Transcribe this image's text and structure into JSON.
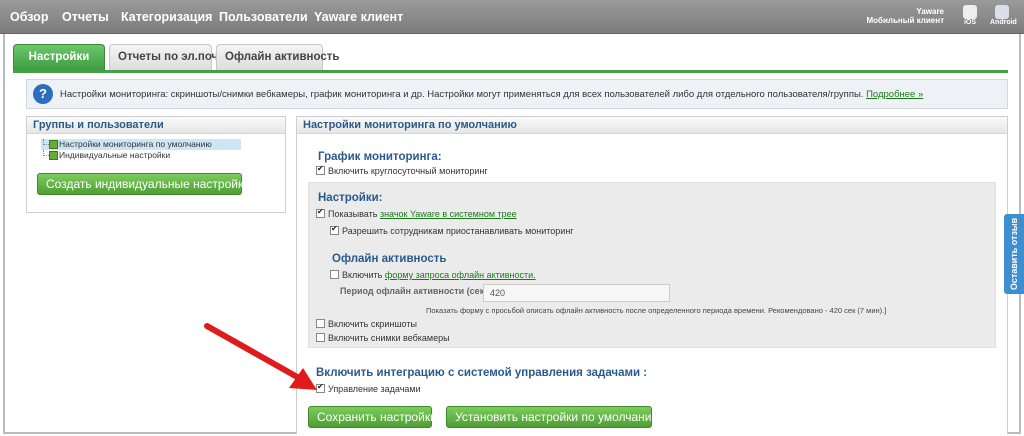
{
  "topnav": {
    "items": [
      "Обзор",
      "Отчеты",
      "Категоризация",
      "Пользователи",
      "Yaware клиент"
    ],
    "mobile_title": "Yaware",
    "mobile_subtitle": "Мобильный клиент",
    "ios_label": "iOS",
    "android_label": "Android"
  },
  "tabs": [
    {
      "label": "Настройки",
      "active": true
    },
    {
      "label": "Отчеты по эл.почте",
      "active": false
    },
    {
      "label": "Офлайн активность",
      "active": false
    }
  ],
  "info": {
    "text": "Настройки мониторинга: скриншоты/снимки вебкамеры, график мониторинга и др. Настройки могут применяться для всех пользователей либо для отдельного пользователя/группы.",
    "link": "Подробнее »"
  },
  "left_panel": {
    "title": "Группы и пользователи",
    "tree": [
      "Настройки мониторинга по умолчанию",
      "Индивидуальные настройки"
    ],
    "create_button": "Создать индивидуальные настройки"
  },
  "right_panel": {
    "title": "Настройки мониторинга по умолчанию",
    "schedule": {
      "title": "График мониторинга:",
      "round_clock": {
        "label": "Включить круглосуточный мониторинг",
        "checked": true
      }
    },
    "settings": {
      "title": "Настройки:",
      "show_prefix": "Показывать",
      "show_link": "значок Yaware в системном трее",
      "show_checked": true,
      "allow_pause": {
        "label": "Разрешить сотрудникам приостанавливать мониторинг",
        "checked": true
      }
    },
    "offline": {
      "title": "Офлайн активность",
      "enable_prefix": "Включить",
      "enable_link": "форму запроса офлайн активности.",
      "enable_checked": false,
      "period_label": "Период офлайн активности (сек):",
      "period_value": "420",
      "hint": "Показать форму с просьбой описать офлайн активность после определенного периода времени. Рекомендовано - 420 сек (7 мин).]"
    },
    "screenshots": {
      "label": "Включить скриншоты",
      "checked": false
    },
    "webcam": {
      "label": "Включить снимки вебкамеры",
      "checked": false
    },
    "tasks": {
      "title": "Включить интеграцию с системой управления задачами :",
      "manage": {
        "label": "Управление задачами",
        "checked": true
      }
    },
    "save_button": "Сохранить настройки",
    "default_button": "Установить настройки по умолчанию"
  },
  "feedback_label": "Оставить отзыв",
  "colors": {
    "accent_green": "#45a045",
    "title_blue": "#2a5a8a",
    "link_green": "#1a7a1a",
    "arrow_red": "#e01b1b",
    "feedback_blue": "#3f8fd0"
  }
}
